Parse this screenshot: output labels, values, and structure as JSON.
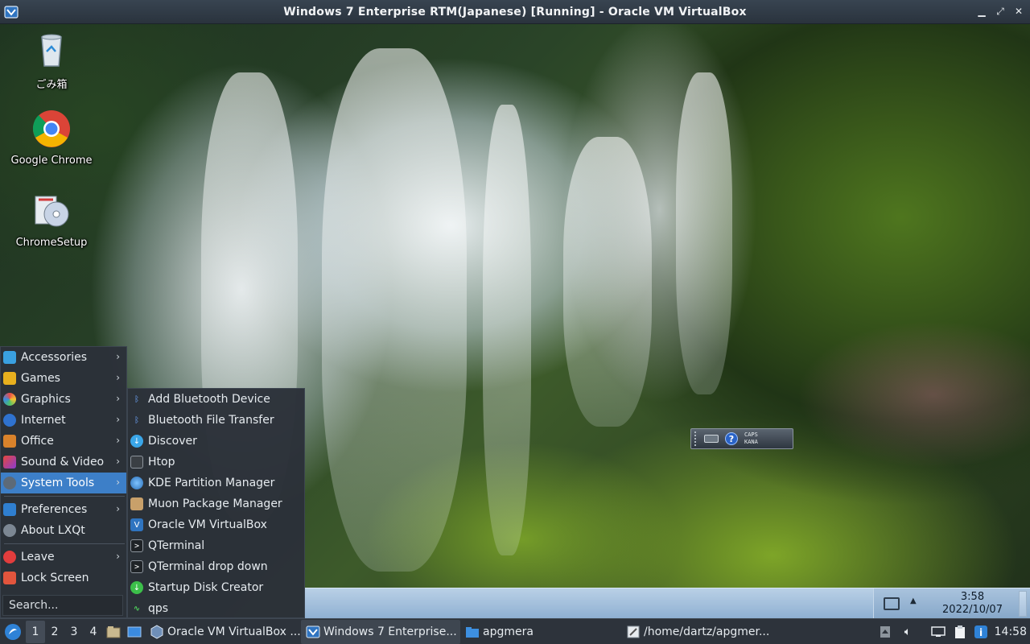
{
  "window": {
    "title": "Windows 7 Enterprise RTM(Japanese) [Running] - Oracle VM VirtualBox",
    "controls": [
      "minimize",
      "maximize",
      "close"
    ]
  },
  "desktop": {
    "icons": [
      {
        "label": "ごみ箱",
        "icon": "recycle-bin-icon"
      },
      {
        "label": "Google Chrome",
        "icon": "chrome-icon"
      },
      {
        "label": "ChromeSetup",
        "icon": "installer-icon"
      }
    ],
    "language_bar": {
      "caps": "CAPS",
      "kana": "KANA",
      "help": "?"
    }
  },
  "guest_taskbar": {
    "clock_time": "3:58",
    "clock_date": "2022/10/07"
  },
  "menu": {
    "items": [
      {
        "label": "Accessories",
        "submenu": true
      },
      {
        "label": "Games",
        "submenu": true
      },
      {
        "label": "Graphics",
        "submenu": true
      },
      {
        "label": "Internet",
        "submenu": true
      },
      {
        "label": "Office",
        "submenu": true
      },
      {
        "label": "Sound & Video",
        "submenu": true
      },
      {
        "label": "System Tools",
        "submenu": true,
        "active": true
      },
      {
        "label": "Preferences",
        "submenu": true
      },
      {
        "label": "About LXQt",
        "submenu": false
      },
      {
        "label": "Leave",
        "submenu": true
      },
      {
        "label": "Lock Screen",
        "submenu": false
      }
    ],
    "search_placeholder": "Search..."
  },
  "submenu": {
    "items": [
      {
        "label": "Add Bluetooth Device"
      },
      {
        "label": "Bluetooth File Transfer"
      },
      {
        "label": "Discover"
      },
      {
        "label": "Htop"
      },
      {
        "label": "KDE Partition Manager"
      },
      {
        "label": "Muon Package Manager"
      },
      {
        "label": "Oracle VM VirtualBox"
      },
      {
        "label": "QTerminal"
      },
      {
        "label": "QTerminal drop down"
      },
      {
        "label": "Startup Disk Creator"
      },
      {
        "label": "qps"
      }
    ]
  },
  "panel": {
    "desktops": [
      "1",
      "2",
      "3",
      "4"
    ],
    "active_desktop": "1",
    "tasks": [
      {
        "label": "Oracle VM VirtualBox ...",
        "icon": "virtualbox-icon"
      },
      {
        "label": "Windows 7 Enterprise...",
        "icon": "virtualbox-vm-icon",
        "active": true
      },
      {
        "label": "apgmera",
        "icon": "folder-icon"
      },
      {
        "label": "/home/dartz/apgmer...",
        "icon": "editor-icon"
      }
    ],
    "clock": "14:58"
  },
  "colors": {
    "menu_bg": "#2b3139",
    "menu_highlight": "#3d7fc8",
    "panel_bg": "#2d333b",
    "titlebar_bg": "#2a333d"
  }
}
